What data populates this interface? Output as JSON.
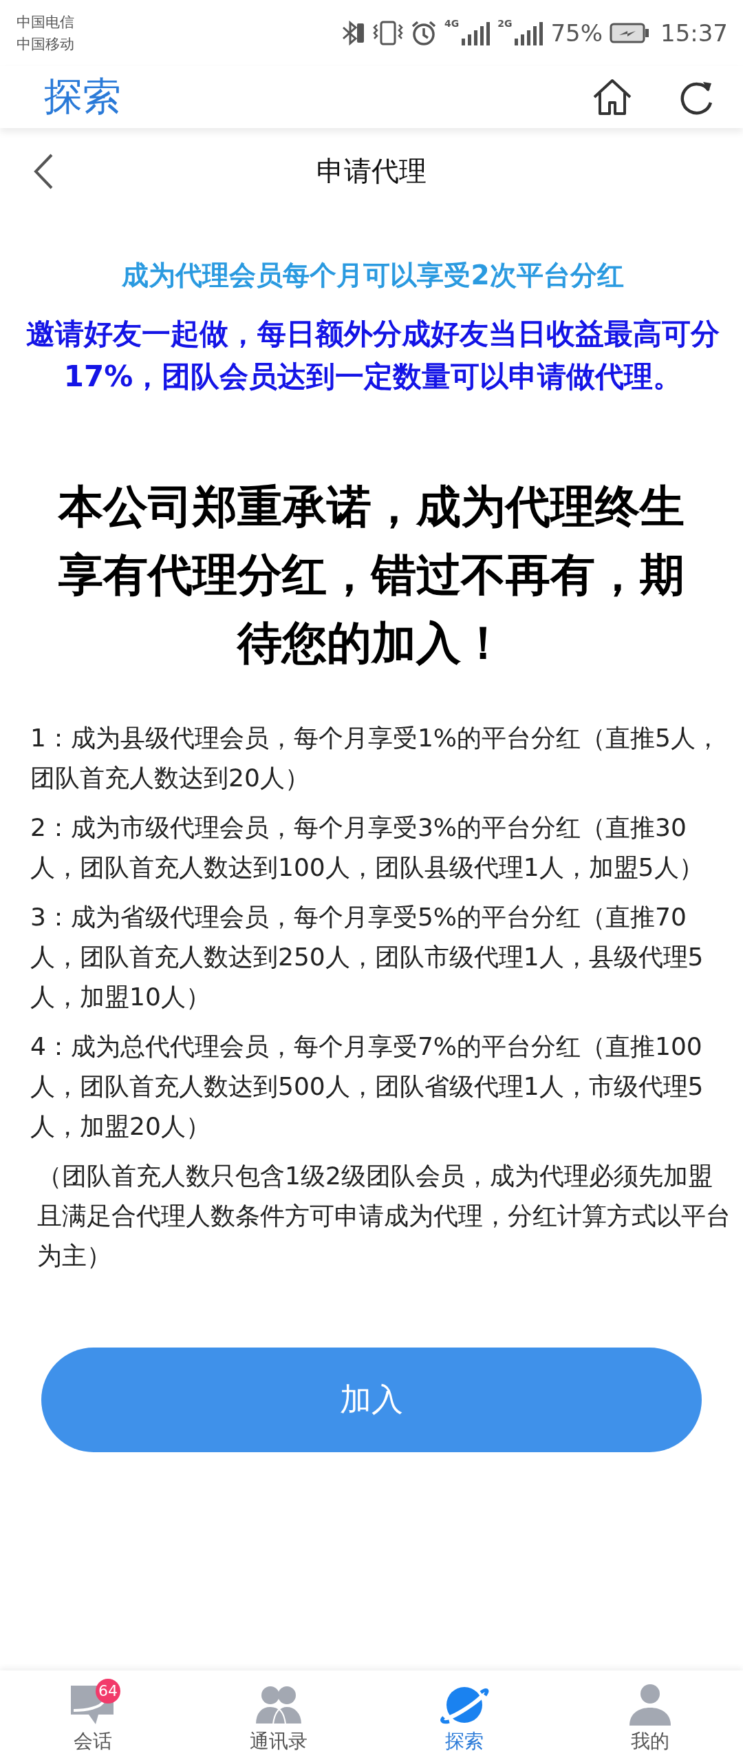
{
  "status_bar": {
    "carriers": [
      "中国电信",
      "中国移动"
    ],
    "network_labels": [
      "4G",
      "2G"
    ],
    "battery": "75%",
    "time": "15:37"
  },
  "app_bar": {
    "title": "探索"
  },
  "page": {
    "title": "申请代理"
  },
  "intro": [
    {
      "kind": "highlight",
      "text": "成为代理会员每个月可以享受2次平台分红"
    },
    {
      "kind": "emphasis",
      "text": "邀请好友一起做，每日额外分成好友当日收益最高可分17%，团队会员达到一定数量可以申请做代理。"
    }
  ],
  "promise": "本公司郑重承诺，成为代理终生享有代理分红，错过不再有，期待您的加入！",
  "tiers": [
    "1：成为县级代理会员，每个月享受1%的平台分红（直推5人，团队首充人数达到20人）",
    "2：成为市级代理会员，每个月享受3%的平台分红（直推30人，团队首充人数达到100人，团队县级代理1人，加盟5人）",
    "3：成为省级代理会员，每个月享受5%的平台分红（直推70人，团队首充人数达到250人，团队市级代理1人，县级代理5人，加盟10人）",
    "4：成为总代代理会员，每个月享受7%的平台分红（直推100人，团队首充人数达到500人，团队省级代理1人，市级代理5人，加盟20人）"
  ],
  "note": "（团队首充人数只包含1级2级团队会员，成为代理必须先加盟且满足合代理人数条件方可申请成为代理，分红计算方式以平台为主）",
  "join_button": "加入",
  "nav": [
    {
      "label": "会话",
      "selected": false,
      "badge": "64"
    },
    {
      "label": "通讯录",
      "selected": false
    },
    {
      "label": "探索",
      "selected": true
    },
    {
      "label": "我的",
      "selected": false
    }
  ]
}
